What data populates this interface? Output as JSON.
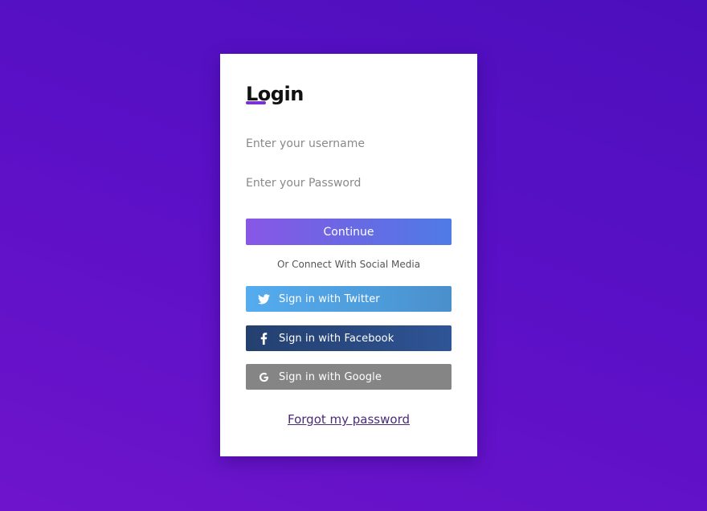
{
  "login": {
    "title": "Login",
    "username_placeholder": "Enter your username",
    "password_placeholder": "Enter your Password",
    "continue_label": "Continue",
    "social_caption": "Or Connect With Social Media",
    "twitter_label": "Sign in with Twitter",
    "facebook_label": "Sign in with Facebook",
    "google_label": "Sign in with Google",
    "forgot_label": "Forgot my password"
  },
  "icons": {
    "twitter": "twitter-icon",
    "facebook": "facebook-icon",
    "google": "google-icon"
  },
  "colors": {
    "background_top": "#4c0fbd",
    "background_bottom": "#6e14cc",
    "title_accent": "#7a2fd8",
    "continue_start": "#8857e5",
    "continue_end": "#4f7be6",
    "twitter": "#55acee",
    "facebook": "#2a4b84",
    "google": "#858585",
    "forgot_link": "#4a2a7a"
  }
}
